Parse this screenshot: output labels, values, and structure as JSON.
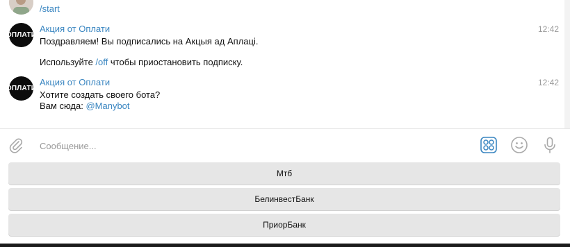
{
  "messages": [
    {
      "sender": "",
      "command": "/start",
      "avatar": "user-photo"
    },
    {
      "sender": "Акция от Оплати",
      "avatar_text": "ОПЛАТИ",
      "time": "12:42",
      "line1": "Поздравляем! Вы подписались на Акцыя ад Аплаці.",
      "line2_before": "Используйте ",
      "line2_link": "/off",
      "line2_after": " чтобы приостановить подписку."
    },
    {
      "sender": "Акция от Оплати",
      "avatar_text": "ОПЛАТИ",
      "time": "12:42",
      "line1": "Хотите создать своего бота?",
      "line2_before": "Вам сюда: ",
      "line2_link": "@Manybot"
    }
  ],
  "composer": {
    "placeholder": "Сообщение..."
  },
  "keyboard": {
    "buttons": [
      "Мтб",
      "БелинвестБанк",
      "ПриорБанк"
    ]
  },
  "icons": {
    "attach": "paperclip-icon",
    "bot_keyboard": "bot-keyboard-icon",
    "emoji": "emoji-icon",
    "mic": "microphone-icon"
  },
  "colors": {
    "accent": "#3a86c1",
    "keyboard_button": "#e6e6e6"
  }
}
